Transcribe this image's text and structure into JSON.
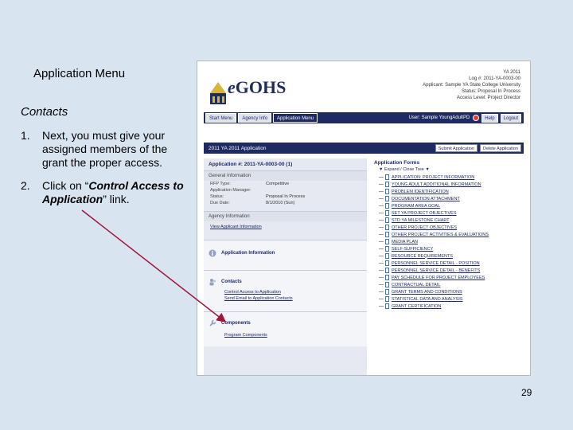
{
  "slide": {
    "title": "Application Menu",
    "section": "Contacts",
    "steps": [
      {
        "num": "1.",
        "text": "Next, you must give your assigned members of the grant the proper access."
      },
      {
        "num": "2.",
        "pre": "Click on “",
        "link": "Control Access to Application",
        "post": "” link."
      }
    ],
    "page_number": "29"
  },
  "screen": {
    "brand_prefix": "e",
    "brand_name": "GOHS",
    "meta": [
      "YA 2011",
      "Log #: 2011-YA-0003-00",
      "Applicant: Sample YA State College University",
      "Status: Proposal In Process",
      "Access Level: Project Director"
    ],
    "nav_tabs": [
      "Start Menu",
      "Agency Info",
      "Application Menu"
    ],
    "user_label": "User: Sample YoungAdultPD",
    "help_label": "Help",
    "logout_label": "Logout",
    "app_bar_title": "2011 YA 2011 Application",
    "submit_label": "Submit Application",
    "delete_label": "Delete Application",
    "application_id": "Application #: 2011-YA-0003-00 (1)",
    "general_info_title": "General Information",
    "general_info": [
      {
        "k": "RFP Type:",
        "v": "Competitive"
      },
      {
        "k": "Application Manager:",
        "v": ""
      },
      {
        "k": "Status:",
        "v": "Proposal In Process"
      },
      {
        "k": "Due Date:",
        "v": "8/1/2010 (Sun)"
      }
    ],
    "agency_info_title": "Agency Information",
    "agency_info_link": "View Applicant Information",
    "app_info_title": "Application Information",
    "contacts_title": "Contacts",
    "contacts_links": [
      "Control Access to Application",
      "Send Email to Application Contacts"
    ],
    "components_title": "Components",
    "components_links": [
      "Program Components"
    ],
    "forms_title": "Application Forms",
    "expand_label": "Expand / Close Tree",
    "forms": [
      "APPLICATION: PROJECT INFORMATION",
      "YOUNG ADULT ADDITIONAL INFORMATION",
      "PROBLEM IDENTIFICATION",
      "DOCUMENTATION ATTACHMENT",
      "PROGRAM AREA GOAL",
      "SET YA PROJECT OBJECTIVES",
      "STD YA MILESTONE CHART",
      "OTHER PROJECT OBJECTIVES",
      "OTHER PROJECT ACTIVITIES & EVALUATIONS",
      "MEDIA PLAN",
      "SELF-SUFFICIENCY",
      "RESOURCE REQUIREMENTS",
      "PERSONNEL SERVICE DETAIL - POSITION",
      "PERSONNEL SERVICE DETAIL - BENEFITS",
      "PAY SCHEDULE FOR PROJECT EMPLOYEES",
      "CONTRACTUAL DETAIL",
      "GRANT TERMS AND CONDITIONS",
      "STATISTICAL DATA AND ANALYSIS",
      "GRANT CERTIFICATION"
    ]
  },
  "colors": {
    "nav": "#1e2a62",
    "slide_bg": "#d9e4f1",
    "arrow": "#a4133c"
  }
}
